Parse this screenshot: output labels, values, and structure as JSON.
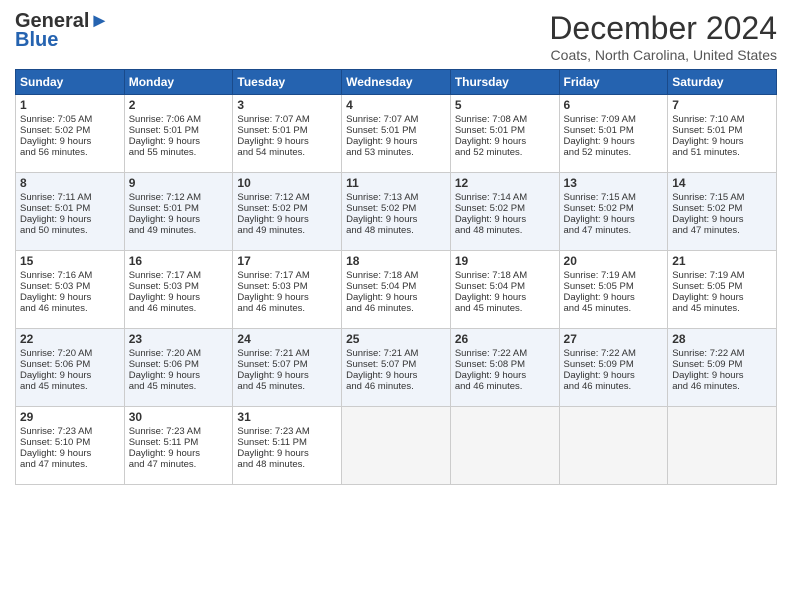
{
  "header": {
    "logo_line1": "General",
    "logo_line2": "Blue",
    "month": "December 2024",
    "location": "Coats, North Carolina, United States"
  },
  "days_of_week": [
    "Sunday",
    "Monday",
    "Tuesday",
    "Wednesday",
    "Thursday",
    "Friday",
    "Saturday"
  ],
  "weeks": [
    [
      {
        "day": "1",
        "lines": [
          "Sunrise: 7:05 AM",
          "Sunset: 5:02 PM",
          "Daylight: 9 hours",
          "and 56 minutes."
        ]
      },
      {
        "day": "2",
        "lines": [
          "Sunrise: 7:06 AM",
          "Sunset: 5:01 PM",
          "Daylight: 9 hours",
          "and 55 minutes."
        ]
      },
      {
        "day": "3",
        "lines": [
          "Sunrise: 7:07 AM",
          "Sunset: 5:01 PM",
          "Daylight: 9 hours",
          "and 54 minutes."
        ]
      },
      {
        "day": "4",
        "lines": [
          "Sunrise: 7:07 AM",
          "Sunset: 5:01 PM",
          "Daylight: 9 hours",
          "and 53 minutes."
        ]
      },
      {
        "day": "5",
        "lines": [
          "Sunrise: 7:08 AM",
          "Sunset: 5:01 PM",
          "Daylight: 9 hours",
          "and 52 minutes."
        ]
      },
      {
        "day": "6",
        "lines": [
          "Sunrise: 7:09 AM",
          "Sunset: 5:01 PM",
          "Daylight: 9 hours",
          "and 52 minutes."
        ]
      },
      {
        "day": "7",
        "lines": [
          "Sunrise: 7:10 AM",
          "Sunset: 5:01 PM",
          "Daylight: 9 hours",
          "and 51 minutes."
        ]
      }
    ],
    [
      {
        "day": "8",
        "lines": [
          "Sunrise: 7:11 AM",
          "Sunset: 5:01 PM",
          "Daylight: 9 hours",
          "and 50 minutes."
        ]
      },
      {
        "day": "9",
        "lines": [
          "Sunrise: 7:12 AM",
          "Sunset: 5:01 PM",
          "Daylight: 9 hours",
          "and 49 minutes."
        ]
      },
      {
        "day": "10",
        "lines": [
          "Sunrise: 7:12 AM",
          "Sunset: 5:02 PM",
          "Daylight: 9 hours",
          "and 49 minutes."
        ]
      },
      {
        "day": "11",
        "lines": [
          "Sunrise: 7:13 AM",
          "Sunset: 5:02 PM",
          "Daylight: 9 hours",
          "and 48 minutes."
        ]
      },
      {
        "day": "12",
        "lines": [
          "Sunrise: 7:14 AM",
          "Sunset: 5:02 PM",
          "Daylight: 9 hours",
          "and 48 minutes."
        ]
      },
      {
        "day": "13",
        "lines": [
          "Sunrise: 7:15 AM",
          "Sunset: 5:02 PM",
          "Daylight: 9 hours",
          "and 47 minutes."
        ]
      },
      {
        "day": "14",
        "lines": [
          "Sunrise: 7:15 AM",
          "Sunset: 5:02 PM",
          "Daylight: 9 hours",
          "and 47 minutes."
        ]
      }
    ],
    [
      {
        "day": "15",
        "lines": [
          "Sunrise: 7:16 AM",
          "Sunset: 5:03 PM",
          "Daylight: 9 hours",
          "and 46 minutes."
        ]
      },
      {
        "day": "16",
        "lines": [
          "Sunrise: 7:17 AM",
          "Sunset: 5:03 PM",
          "Daylight: 9 hours",
          "and 46 minutes."
        ]
      },
      {
        "day": "17",
        "lines": [
          "Sunrise: 7:17 AM",
          "Sunset: 5:03 PM",
          "Daylight: 9 hours",
          "and 46 minutes."
        ]
      },
      {
        "day": "18",
        "lines": [
          "Sunrise: 7:18 AM",
          "Sunset: 5:04 PM",
          "Daylight: 9 hours",
          "and 46 minutes."
        ]
      },
      {
        "day": "19",
        "lines": [
          "Sunrise: 7:18 AM",
          "Sunset: 5:04 PM",
          "Daylight: 9 hours",
          "and 45 minutes."
        ]
      },
      {
        "day": "20",
        "lines": [
          "Sunrise: 7:19 AM",
          "Sunset: 5:05 PM",
          "Daylight: 9 hours",
          "and 45 minutes."
        ]
      },
      {
        "day": "21",
        "lines": [
          "Sunrise: 7:19 AM",
          "Sunset: 5:05 PM",
          "Daylight: 9 hours",
          "and 45 minutes."
        ]
      }
    ],
    [
      {
        "day": "22",
        "lines": [
          "Sunrise: 7:20 AM",
          "Sunset: 5:06 PM",
          "Daylight: 9 hours",
          "and 45 minutes."
        ]
      },
      {
        "day": "23",
        "lines": [
          "Sunrise: 7:20 AM",
          "Sunset: 5:06 PM",
          "Daylight: 9 hours",
          "and 45 minutes."
        ]
      },
      {
        "day": "24",
        "lines": [
          "Sunrise: 7:21 AM",
          "Sunset: 5:07 PM",
          "Daylight: 9 hours",
          "and 45 minutes."
        ]
      },
      {
        "day": "25",
        "lines": [
          "Sunrise: 7:21 AM",
          "Sunset: 5:07 PM",
          "Daylight: 9 hours",
          "and 46 minutes."
        ]
      },
      {
        "day": "26",
        "lines": [
          "Sunrise: 7:22 AM",
          "Sunset: 5:08 PM",
          "Daylight: 9 hours",
          "and 46 minutes."
        ]
      },
      {
        "day": "27",
        "lines": [
          "Sunrise: 7:22 AM",
          "Sunset: 5:09 PM",
          "Daylight: 9 hours",
          "and 46 minutes."
        ]
      },
      {
        "day": "28",
        "lines": [
          "Sunrise: 7:22 AM",
          "Sunset: 5:09 PM",
          "Daylight: 9 hours",
          "and 46 minutes."
        ]
      }
    ],
    [
      {
        "day": "29",
        "lines": [
          "Sunrise: 7:23 AM",
          "Sunset: 5:10 PM",
          "Daylight: 9 hours",
          "and 47 minutes."
        ]
      },
      {
        "day": "30",
        "lines": [
          "Sunrise: 7:23 AM",
          "Sunset: 5:11 PM",
          "Daylight: 9 hours",
          "and 47 minutes."
        ]
      },
      {
        "day": "31",
        "lines": [
          "Sunrise: 7:23 AM",
          "Sunset: 5:11 PM",
          "Daylight: 9 hours",
          "and 48 minutes."
        ]
      },
      {
        "day": "",
        "lines": []
      },
      {
        "day": "",
        "lines": []
      },
      {
        "day": "",
        "lines": []
      },
      {
        "day": "",
        "lines": []
      }
    ]
  ]
}
